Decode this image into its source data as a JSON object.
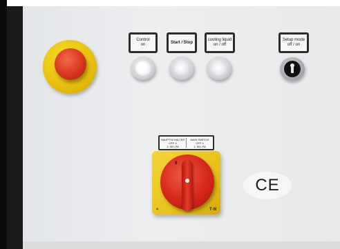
{
  "emergency_stop": {},
  "buttons": [
    {
      "label_lines": [
        "Control",
        "on"
      ]
    },
    {
      "label_lines": [
        "Start / Stop"
      ]
    },
    {
      "label_lines": [
        "cooling liquid",
        "on / off"
      ]
    }
  ],
  "key_switch": {
    "label_lines": [
      "Setup mode",
      "off / on"
    ]
  },
  "main_switch": {
    "label_left": [
      "HAUPTSCHALTER",
      "OFF 0",
      "1: 001-PA"
    ],
    "label_right": [
      "MAIN SWITCH",
      "OFF 0",
      "1: 001-PA"
    ],
    "off_mark": "0",
    "brand_left": "≈",
    "brand_right": "T·N"
  },
  "ce_mark": "CE"
}
